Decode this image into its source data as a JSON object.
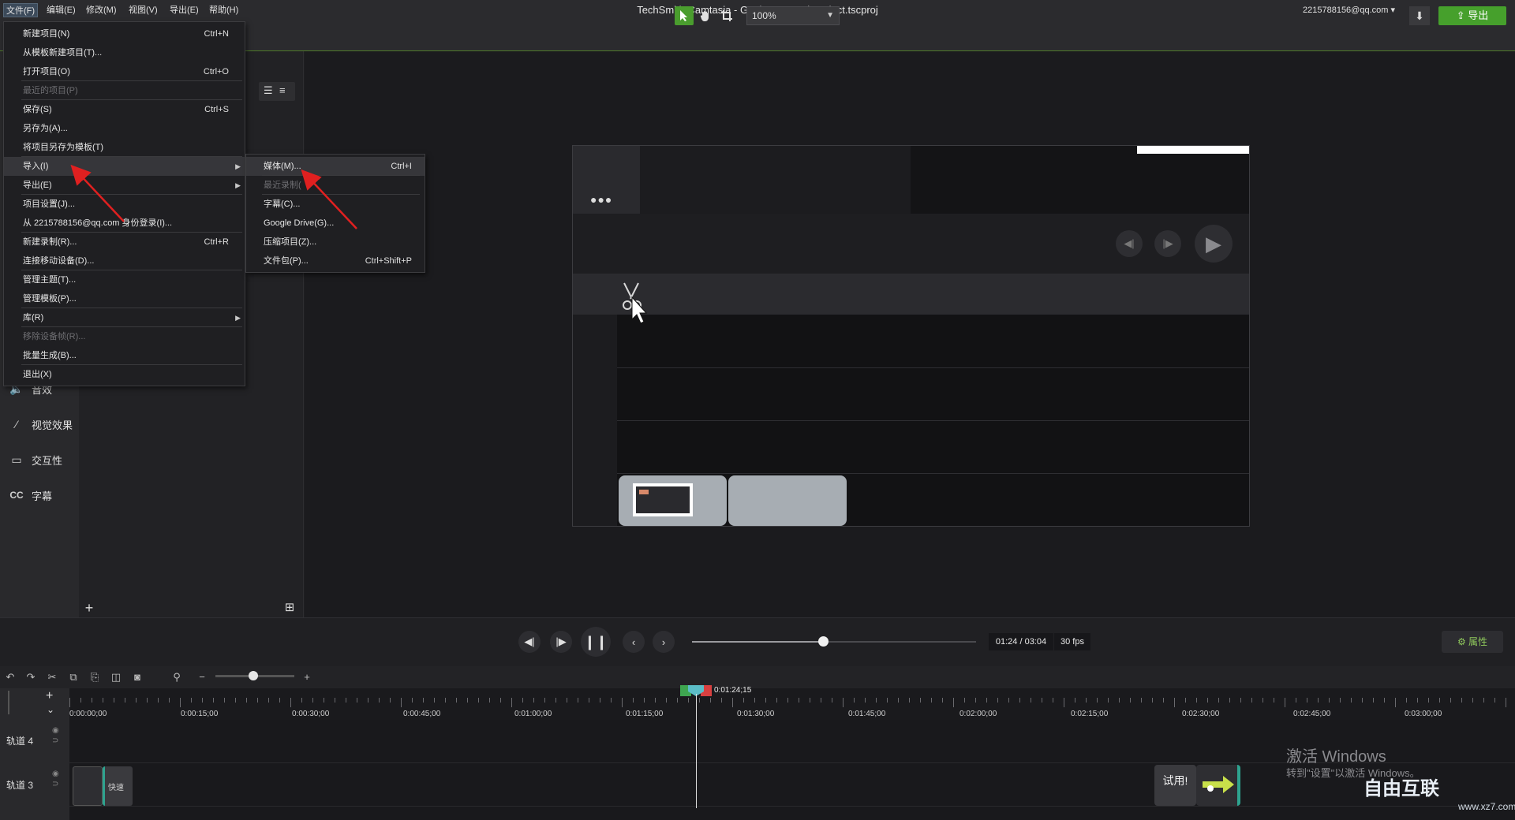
{
  "window": {
    "title": "TechSmith Camtasia - Getting-Started-Project.tscproj",
    "account": "2215788156@qq.com ▾",
    "minimize": "–",
    "restore": "❐",
    "close": "✕"
  },
  "menubar": [
    "文件(F)",
    "编辑(E)",
    "修改(M)",
    "视图(V)",
    "导出(E)",
    "帮助(H)"
  ],
  "toolbar": {
    "zoom": "100%",
    "export_label": "导出"
  },
  "file_menu": [
    {
      "label": "新建项目(N)",
      "shortcut": "Ctrl+N"
    },
    {
      "label": "从模板新建项目(T)..."
    },
    {
      "label": "打开项目(O)",
      "shortcut": "Ctrl+O"
    },
    {
      "label": "最近的项目(P)",
      "disabled": true
    },
    {
      "label": "保存(S)",
      "shortcut": "Ctrl+S"
    },
    {
      "label": "另存为(A)..."
    },
    {
      "label": "将项目另存为模板(T)"
    },
    {
      "label": "导入(I)",
      "submenu": true,
      "highlight": true
    },
    {
      "label": "导出(E)",
      "submenu": true
    },
    {
      "label": "项目设置(J)..."
    },
    {
      "label": "从 2215788156@qq.com 身份登录(I)..."
    },
    {
      "label": "新建录制(R)...",
      "shortcut": "Ctrl+R"
    },
    {
      "label": "连接移动设备(D)..."
    },
    {
      "label": "管理主题(T)..."
    },
    {
      "label": "管理模板(P)..."
    },
    {
      "label": "库(R)",
      "submenu": true
    },
    {
      "label": "移除设备帧(R)...",
      "disabled": true
    },
    {
      "label": "批量生成(B)..."
    },
    {
      "label": "退出(X)"
    }
  ],
  "import_submenu": [
    {
      "label": "媒体(M)...",
      "shortcut": "Ctrl+I",
      "highlight": true
    },
    {
      "label": "最近录制(",
      "disabled": true
    },
    {
      "label": "字幕(C)..."
    },
    {
      "label": "Google Drive(G)..."
    },
    {
      "label": "压缩项目(Z)..."
    },
    {
      "label": "文件包(P)...",
      "shortcut": "Ctrl+Shift+P"
    }
  ],
  "sidebar": [
    {
      "label": "音效",
      "icon": "audio-icon"
    },
    {
      "label": "视觉效果",
      "icon": "wand-icon"
    },
    {
      "label": "交互性",
      "icon": "interactive-icon"
    },
    {
      "label": "字幕",
      "icon": "cc-icon"
    }
  ],
  "playback": {
    "timecode": "01:24 / 03:04",
    "fps": "30 fps",
    "progress": 0.46,
    "properties_label": "属性"
  },
  "timeline": {
    "playhead_time": "0:01:24;15",
    "ruler": [
      "0:00:00;00",
      "0:00:15;00",
      "0:00:30;00",
      "0:00:45;00",
      "0:01:00;00",
      "0:01:15;00",
      "0:01:30;00",
      "0:01:45;00",
      "0:02:00;00",
      "0:02:15;00",
      "0:02:30;00",
      "0:02:45;00",
      "0:03:00;00"
    ],
    "tracks": [
      "轨道 4",
      "轨道 3"
    ],
    "clip_label": "快速",
    "try_label": "试用!"
  },
  "watermark": {
    "line1": "激活 Windows",
    "line2": "转到\"设置\"以激活 Windows。",
    "logo": "自由互联",
    "url": "www.xz7.com"
  },
  "colors": {
    "accent_green": "#46a02c",
    "annotation_red": "#e02020"
  }
}
